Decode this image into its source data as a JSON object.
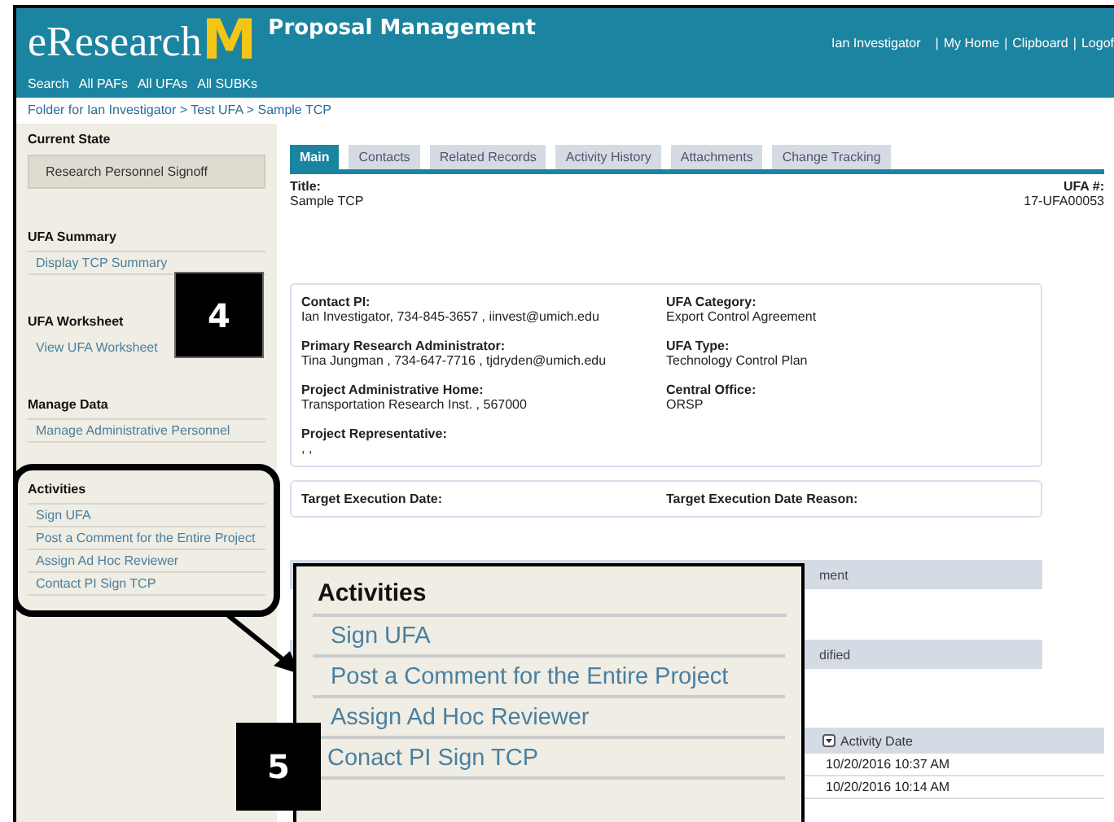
{
  "header": {
    "app_name": "eResearch",
    "logo_mark": "M",
    "module": "Proposal Management",
    "user_bar": [
      {
        "kind": "link",
        "text": "Ian Investigator"
      },
      {
        "kind": "separator",
        "text": "|"
      },
      {
        "kind": "link",
        "text": "My Home"
      },
      {
        "kind": "separator",
        "text": "|"
      },
      {
        "kind": "link",
        "text": "Clipboard"
      },
      {
        "kind": "separator",
        "text": "|"
      },
      {
        "kind": "link",
        "text": "Logof"
      }
    ],
    "nav": [
      "Search",
      "All PAFs",
      "All UFAs",
      "All SUBKs"
    ]
  },
  "breadcrumb": "Folder for Ian Investigator > Test UFA > Sample TCP",
  "sidebar": {
    "sections": [
      {
        "heading": "Current State",
        "kind": "state",
        "value": "Research Personnel Signoff"
      },
      {
        "heading": "UFA Summary",
        "kind": "ruled",
        "links": [
          "Display TCP Summary"
        ]
      },
      {
        "heading": "UFA Worksheet",
        "kind": "plain",
        "links": [
          "View UFA Worksheet"
        ]
      },
      {
        "heading": "Manage Data",
        "kind": "ruled",
        "links": [
          "Manage Administrative Personnel"
        ]
      },
      {
        "heading": "Activities",
        "kind": "ruled",
        "links": [
          "Sign UFA",
          "Post a Comment for the Entire Project",
          "Assign Ad Hoc Reviewer",
          "Contact PI Sign TCP"
        ]
      }
    ]
  },
  "tabs": [
    {
      "label": "Main",
      "selected": true
    },
    {
      "label": "Contacts",
      "selected": false
    },
    {
      "label": "Related Records",
      "selected": false
    },
    {
      "label": "Activity History",
      "selected": false
    },
    {
      "label": "Attachments",
      "selected": false
    },
    {
      "label": "Change Tracking",
      "selected": false
    }
  ],
  "record": {
    "title_label": "Title:",
    "title": "Sample TCP",
    "number_label": "UFA #:",
    "number": "17-UFA00053"
  },
  "details": [
    {
      "label": "Contact PI:",
      "value": "Ian Investigator, 734-845-3657 ,   iinvest@umich.edu"
    },
    {
      "label": "UFA Category:",
      "value": "Export Control Agreement"
    },
    {
      "label": "Primary Research Administrator:",
      "value": "Tina Jungman ,  734-647-7716 ,  tjdryden@umich.edu"
    },
    {
      "label": "UFA Type:",
      "value": "Technology Control Plan"
    },
    {
      "label": "Project Administrative Home:",
      "value": "Transportation Research Inst. ,  567000"
    },
    {
      "label": "Central Office:",
      "value": "ORSP"
    },
    {
      "label": "Project Representative:",
      "value": ",  ,"
    }
  ],
  "target": [
    "Target Execution Date:",
    "Target Execution Date Reason:"
  ],
  "hidden_sections": [
    {
      "bar_text": "ment"
    },
    {
      "bar_text": "dified"
    }
  ],
  "activity_table": {
    "column": "Activity Date",
    "rows": [
      "10/20/2016 10:37 AM",
      "10/20/2016 10:14 AM"
    ]
  },
  "callouts": [
    "4",
    "5"
  ],
  "zoom_panel": {
    "heading": "Activities",
    "items": [
      "Sign UFA",
      "Post a Comment for the Entire Project",
      "Assign Ad Hoc Reviewer",
      "Conact PI Sign TCP"
    ]
  }
}
